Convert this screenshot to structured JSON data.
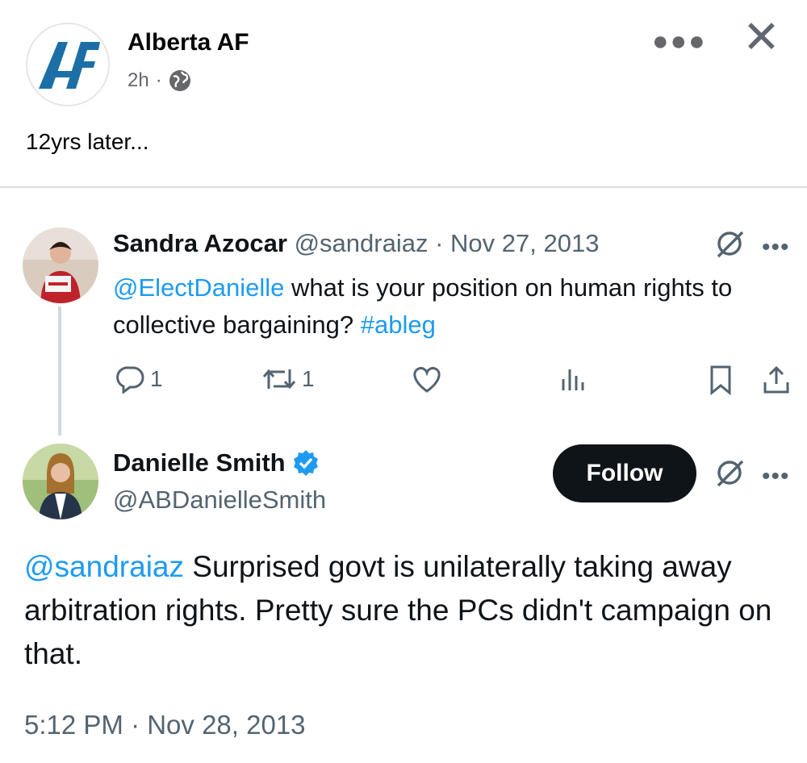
{
  "post": {
    "page_name": "Alberta AF",
    "time": "2h",
    "dot": "·",
    "caption": "12yrs later...",
    "logo_text": "AF",
    "icons": {
      "more": "more-horizontal-icon",
      "close": "close-icon",
      "privacy": "globe-icon"
    }
  },
  "tweet1": {
    "name": "Sandra Azocar",
    "handle": "@sandraiaz",
    "sep": "·",
    "date": "Nov 27, 2013",
    "mention": "@ElectDanielle",
    "text": " what is your position on human rights to collective bargaining? ",
    "hashtag": "#ableg",
    "replies": "1",
    "retweets": "1"
  },
  "tweet2": {
    "name": "Danielle Smith",
    "handle": "@ABDanielleSmith",
    "follow_label": "Follow",
    "mention": "@sandraiaz",
    "text": " Surprised govt is unilaterally taking away arbitration rights. Pretty sure the PCs didn't campaign on that.",
    "timestamp": "5:12 PM · Nov 28, 2013"
  },
  "colors": {
    "link": "#1d9bf0",
    "logo": "#1c6fa6",
    "follow_bg": "#0f1419",
    "verified": "#1d9bf0"
  }
}
